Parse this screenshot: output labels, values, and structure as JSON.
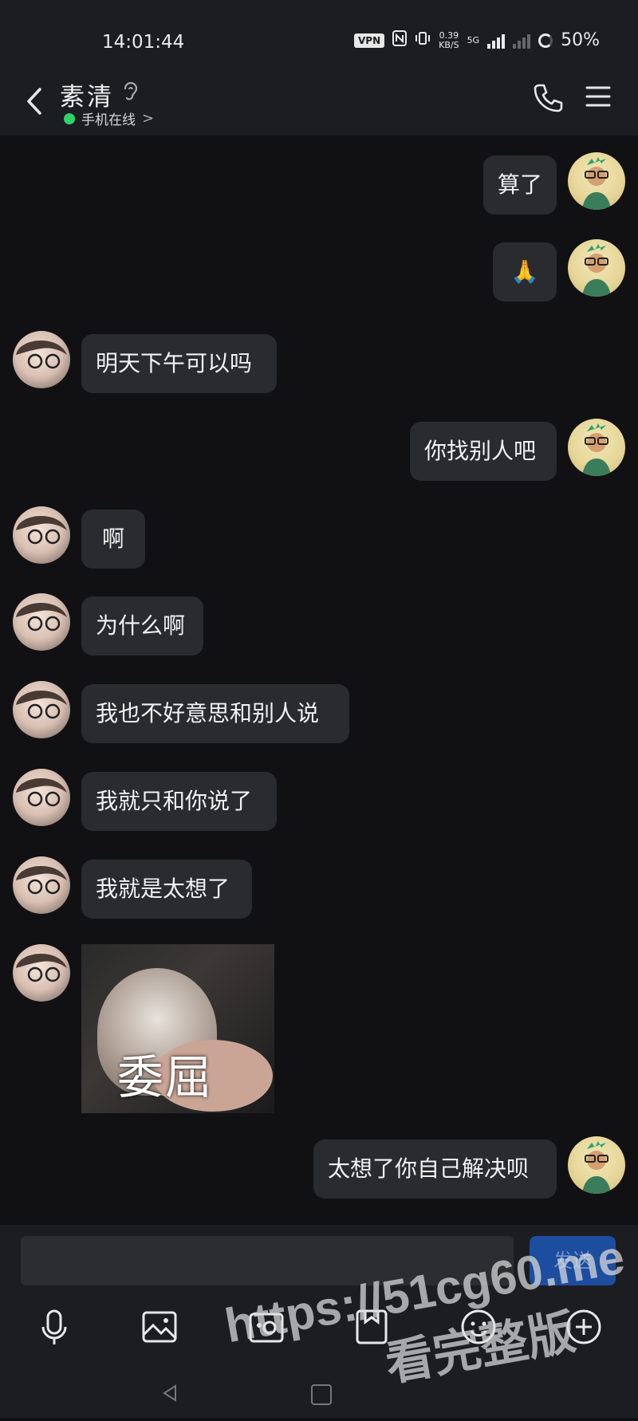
{
  "status_bar": {
    "time": "14:01:44",
    "vpn": "VPN",
    "speed": "0.39",
    "speed_unit": "KB/S",
    "network": "5G",
    "battery": "50%"
  },
  "header": {
    "contact_name": "素清",
    "online_status": "手机在线",
    "chevron": ">"
  },
  "messages": [
    {
      "side": "me",
      "text": "算了"
    },
    {
      "side": "me",
      "text": "🙏"
    },
    {
      "side": "them",
      "text": "明天下午可以吗"
    },
    {
      "side": "me",
      "text": "你找别人吧"
    },
    {
      "side": "them",
      "text": "啊"
    },
    {
      "side": "them",
      "text": "为什么啊"
    },
    {
      "side": "them",
      "text": "我也不好意思和别人说"
    },
    {
      "side": "them",
      "text": "我就只和你说了"
    },
    {
      "side": "them",
      "text": "我就是太想了"
    },
    {
      "side": "them",
      "sticker_caption": "委屈"
    },
    {
      "side": "me",
      "text": "太想了你自己解决呗"
    }
  ],
  "input": {
    "send_label": "发送"
  },
  "toolbar": [
    "mic-icon",
    "image-icon",
    "camera-icon",
    "file-icon",
    "emoji-icon",
    "plus-icon"
  ],
  "watermark": {
    "url": "https://51cg60.me",
    "text": "看完整版"
  },
  "colors": {
    "background": "#111114",
    "bubble": "#2a2b2f",
    "online": "#2fd26b",
    "send": "#1d4d9e"
  }
}
